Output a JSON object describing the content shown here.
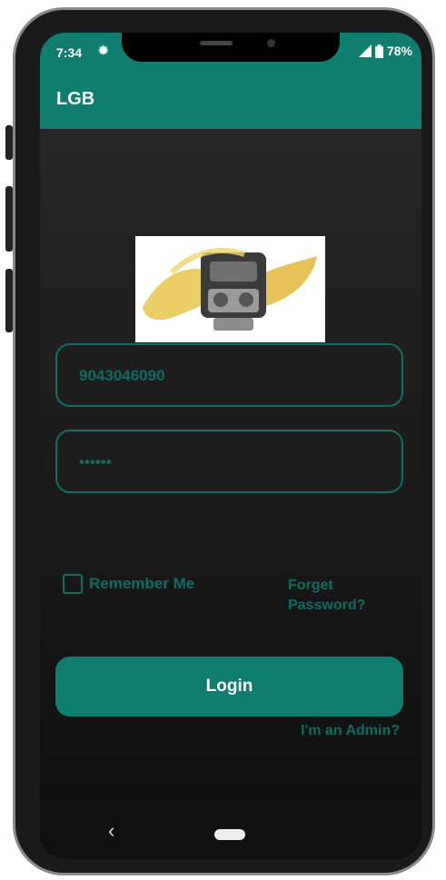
{
  "status": {
    "time": "7:34",
    "battery": "78%"
  },
  "appbar": {
    "title": "LGB"
  },
  "form": {
    "phone_value": "9043046090",
    "password_value": "••••••",
    "remember_label": "Remember Me",
    "forget_label": "Forget Password?",
    "login_label": "Login",
    "admin_label": "I'm an Admin?"
  },
  "colors": {
    "accent": "#0f7d6f",
    "text_accent": "#0b6d60",
    "background": "#141414"
  },
  "icons": [
    "gear-icon",
    "signal-icon",
    "battery-icon",
    "back-icon",
    "home-icon",
    "engine-logo-icon"
  ]
}
